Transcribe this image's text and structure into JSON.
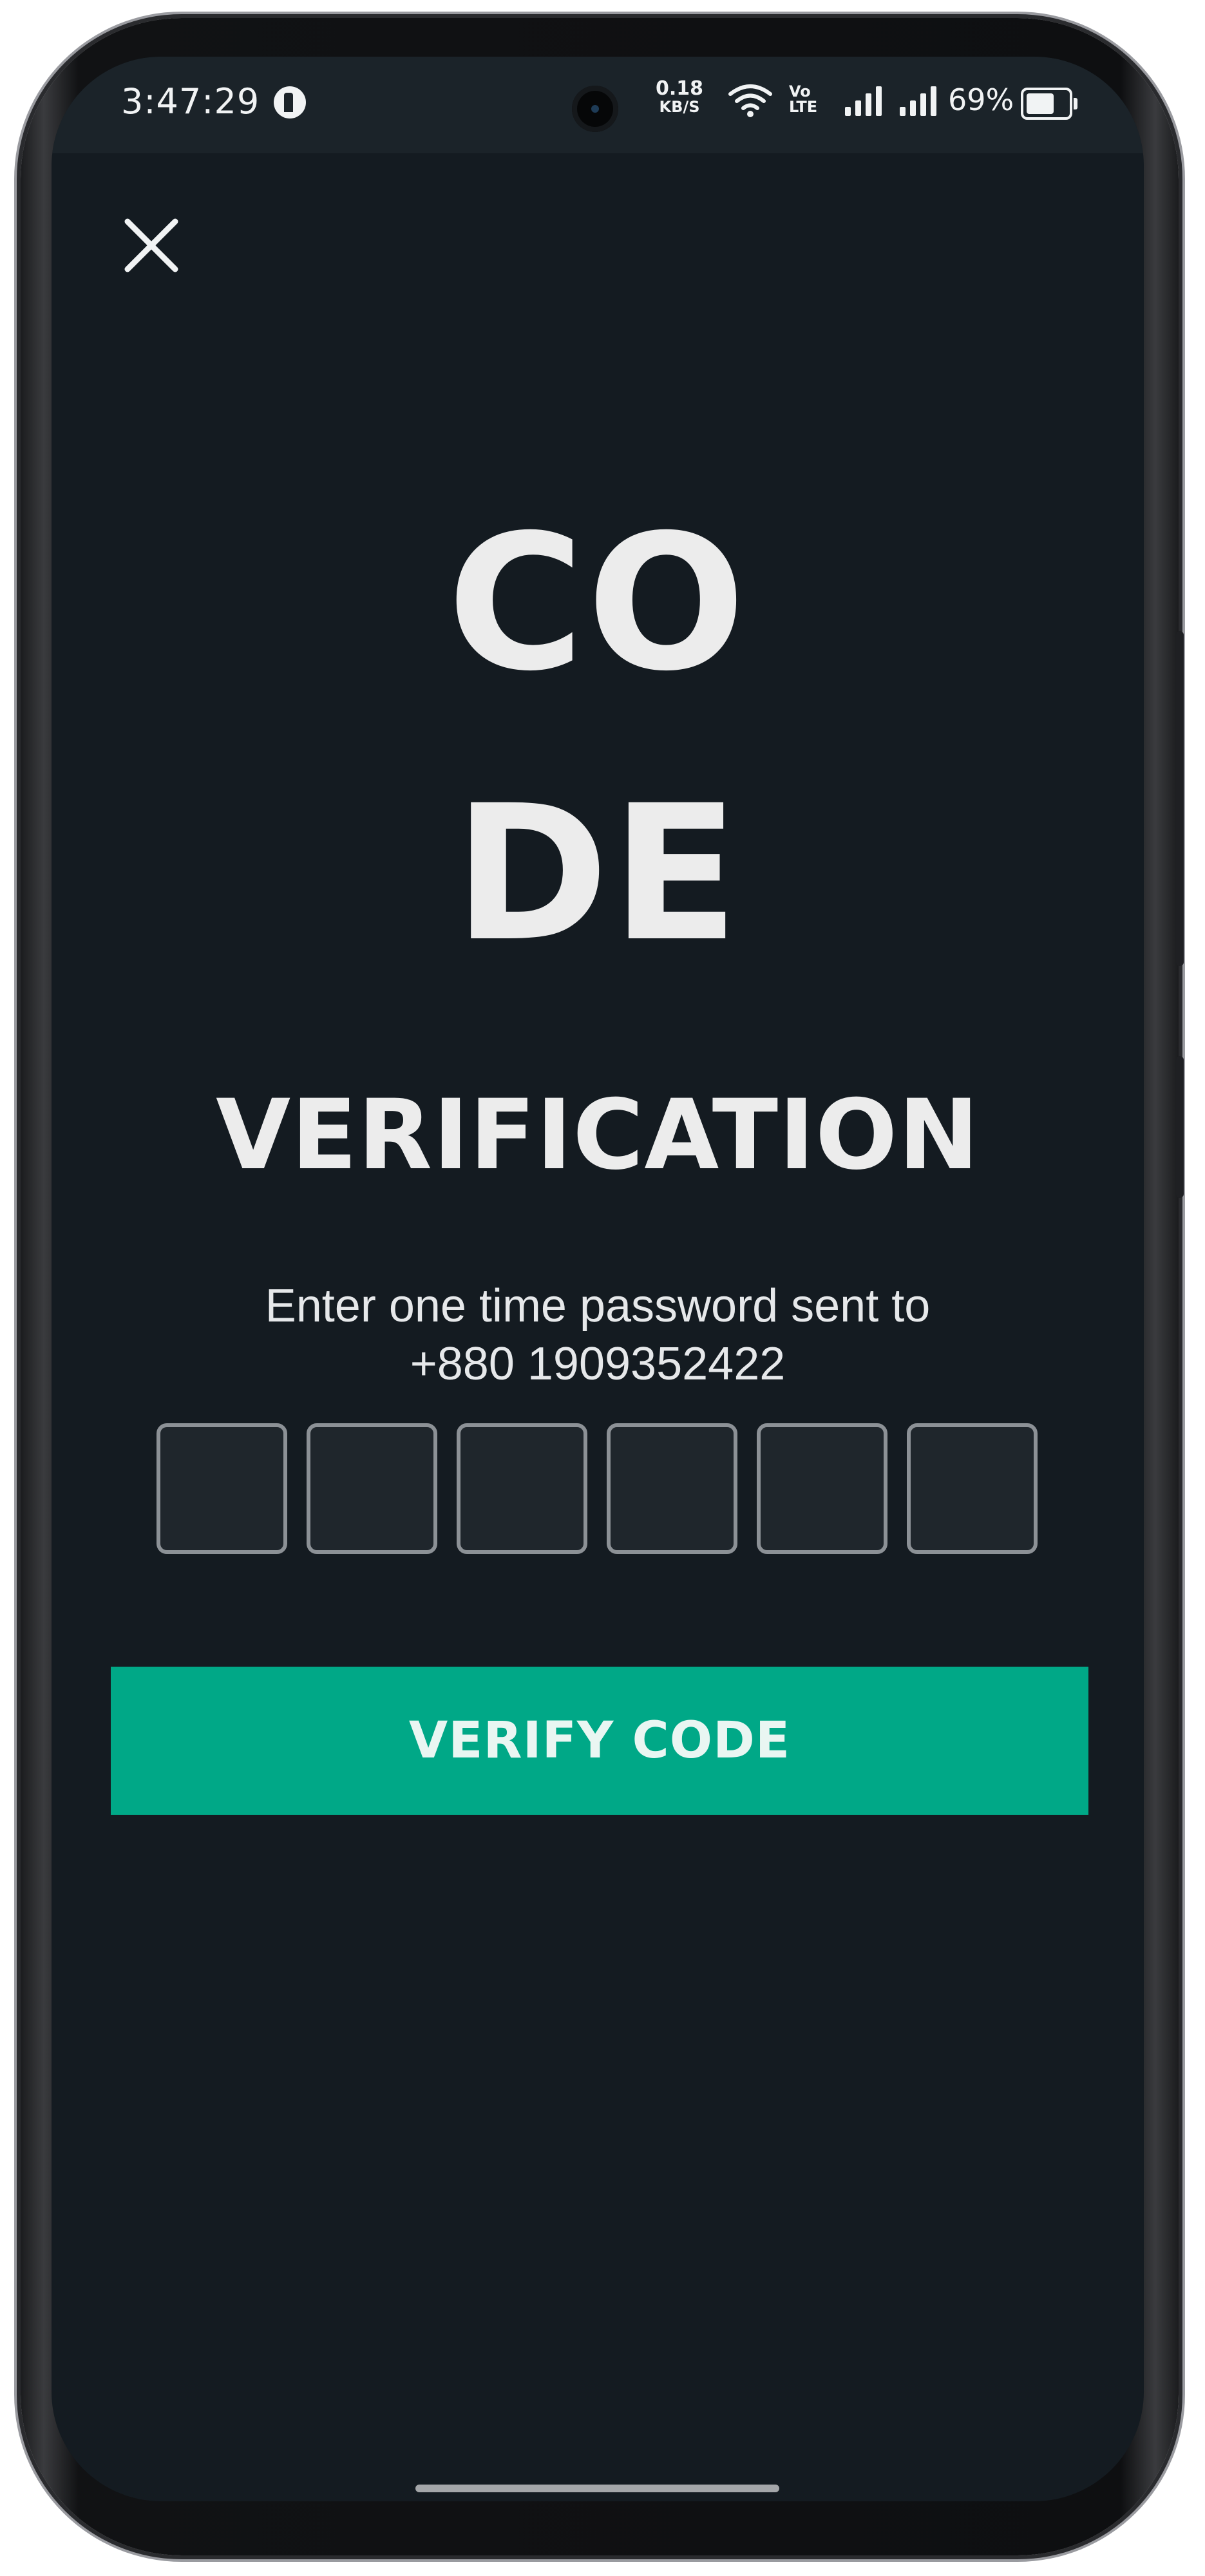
{
  "status_bar": {
    "time": "3:47:29",
    "net_speed_value": "0.18",
    "net_speed_unit": "KB/S",
    "volte_top": "Vo",
    "volte_bottom": "LTE",
    "battery_percent": "69%",
    "icons": [
      "app-notification-icon",
      "wifi-icon",
      "volte-icon",
      "cell-signal-icon",
      "cell-signal-icon",
      "battery-icon"
    ]
  },
  "header": {
    "close_icon": "close-icon"
  },
  "title": {
    "line1": "CO",
    "line2": "DE",
    "line3": "VERIFICATION"
  },
  "instruction": {
    "line1": "Enter one time password sent to",
    "phone": "+880 1909352422"
  },
  "otp": {
    "length": 6,
    "digits": [
      "",
      "",
      "",
      "",
      "",
      ""
    ]
  },
  "actions": {
    "verify_label": "VERIFY CODE"
  },
  "colors": {
    "background": "#141b21",
    "status_bar": "#1b2329",
    "accent": "#00a887",
    "text": "#ececec",
    "otp_border": "#8c9196",
    "otp_fill": "#1f262c"
  }
}
